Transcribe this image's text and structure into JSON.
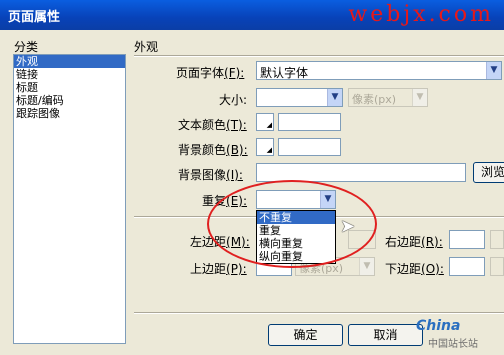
{
  "window": {
    "title": "页面属性",
    "watermark": "webjx.com"
  },
  "category": {
    "label": "分类",
    "items": [
      "外观",
      "链接",
      "标题",
      "标题/编码",
      "跟踪图像"
    ],
    "selected_index": 0
  },
  "section_label": "外观",
  "page_font": {
    "label": "页面字体",
    "key": "(F):",
    "value": "默认字体"
  },
  "size": {
    "label": "大小:",
    "unit": "像素(px)"
  },
  "text_color": {
    "label": "文本颜色",
    "key": "(T):"
  },
  "bg_color": {
    "label": "背景颜色",
    "key": "(B):"
  },
  "bg_image": {
    "label": "背景图像",
    "key": "(I):",
    "browse_label": "浏览"
  },
  "repeat": {
    "label": "重复",
    "key": "(E):",
    "options": [
      "不重复",
      "重复",
      "横向重复",
      "纵向重复"
    ],
    "highlighted_index": 0
  },
  "margins": {
    "left": {
      "label": "左边距",
      "key": "(M):"
    },
    "right": {
      "label": "右边距",
      "key": "(R):"
    },
    "top": {
      "label": "上边距",
      "key": "(P):",
      "unit": "像素(px)"
    },
    "bottom": {
      "label": "下边距",
      "key": "(O):"
    }
  },
  "buttons": {
    "ok": "确定",
    "cancel": "取消"
  },
  "branding": {
    "logo": "China",
    "logo_sub": "中国站长站"
  },
  "colors": {
    "titlebar": "#0a5ee0",
    "selection": "#316ac5",
    "annotation": "#e02020"
  }
}
